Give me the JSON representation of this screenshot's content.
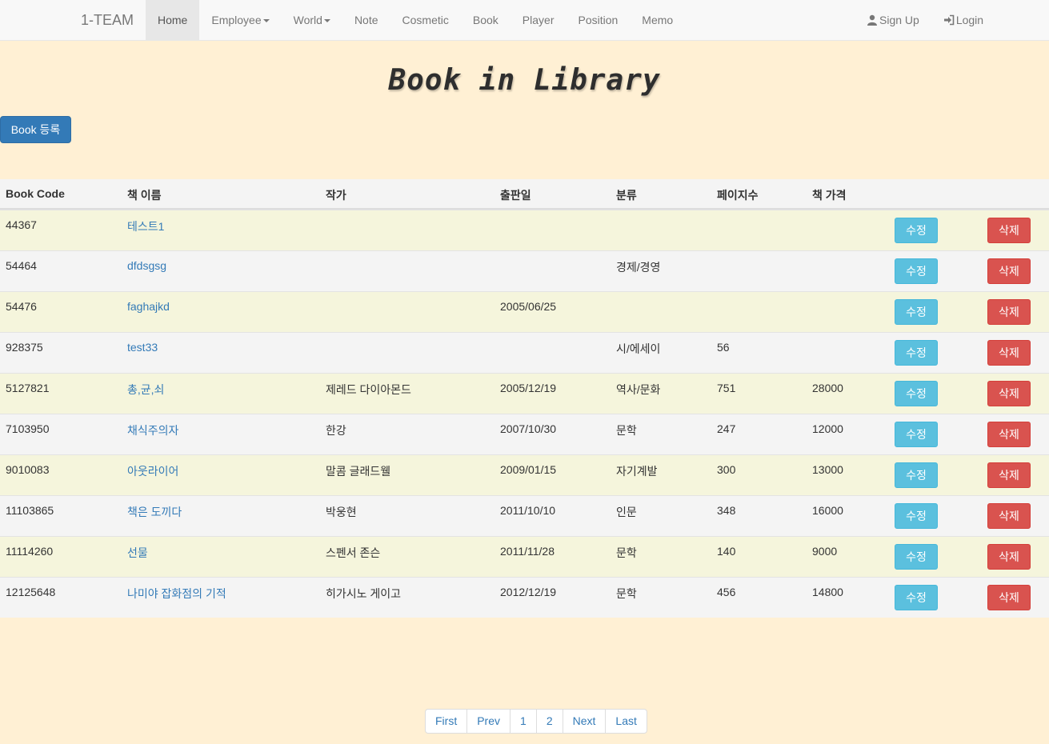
{
  "navbar": {
    "brand": "1-TEAM",
    "items": [
      {
        "label": "Home",
        "active": true
      },
      {
        "label": "Employee",
        "dropdown": true
      },
      {
        "label": "World",
        "dropdown": true
      },
      {
        "label": "Note"
      },
      {
        "label": "Cosmetic"
      },
      {
        "label": "Book"
      },
      {
        "label": "Player"
      },
      {
        "label": "Position"
      },
      {
        "label": "Memo"
      }
    ],
    "signup": {
      "label": "Sign Up",
      "icon": "user-icon"
    },
    "login": {
      "label": "Login",
      "icon": "login-icon"
    }
  },
  "page": {
    "title": "Book in Library",
    "register_button": "Book 등록"
  },
  "table": {
    "headers": [
      "Book Code",
      "책 이름",
      "작가",
      "출판일",
      "분류",
      "페이지수",
      "책 가격"
    ],
    "edit_label": "수정",
    "delete_label": "삭제",
    "rows": [
      {
        "code": "44367",
        "name": "테스트1",
        "author": "",
        "date": "",
        "category": "",
        "pages": "",
        "price": ""
      },
      {
        "code": "54464",
        "name": "dfdsgsg",
        "author": "",
        "date": "",
        "category": "경제/경영",
        "pages": "",
        "price": ""
      },
      {
        "code": "54476",
        "name": "faghajkd",
        "author": "",
        "date": "2005/06/25",
        "category": "",
        "pages": "",
        "price": ""
      },
      {
        "code": "928375",
        "name": "test33",
        "author": "",
        "date": "",
        "category": "시/에세이",
        "pages": "56",
        "price": ""
      },
      {
        "code": "5127821",
        "name": "총,균,쇠",
        "author": "제레드 다이아몬드",
        "date": "2005/12/19",
        "category": "역사/문화",
        "pages": "751",
        "price": "28000"
      },
      {
        "code": "7103950",
        "name": "채식주의자",
        "author": "한강",
        "date": "2007/10/30",
        "category": "문학",
        "pages": "247",
        "price": "12000"
      },
      {
        "code": "9010083",
        "name": "아웃라이어",
        "author": "말콤 글래드웰",
        "date": "2009/01/15",
        "category": "자기계발",
        "pages": "300",
        "price": "13000"
      },
      {
        "code": "11103865",
        "name": "책은 도끼다",
        "author": "박웅현",
        "date": "2011/10/10",
        "category": "인문",
        "pages": "348",
        "price": "16000"
      },
      {
        "code": "11114260",
        "name": "선물",
        "author": "스펜서 존슨",
        "date": "2011/11/28",
        "category": "문학",
        "pages": "140",
        "price": "9000"
      },
      {
        "code": "12125648",
        "name": "나미야 잡화점의 기적",
        "author": "히가시노 게이고",
        "date": "2012/12/19",
        "category": "문학",
        "pages": "456",
        "price": "14800"
      }
    ]
  },
  "pagination": [
    "First",
    "Prev",
    "1",
    "2",
    "Next",
    "Last"
  ],
  "colors": {
    "background": "#fff0d4",
    "primary": "#337ab7",
    "info": "#5bc0de",
    "danger": "#d9534f",
    "row_odd": "#f5f5dc",
    "row_even": "#f4f4f4"
  }
}
